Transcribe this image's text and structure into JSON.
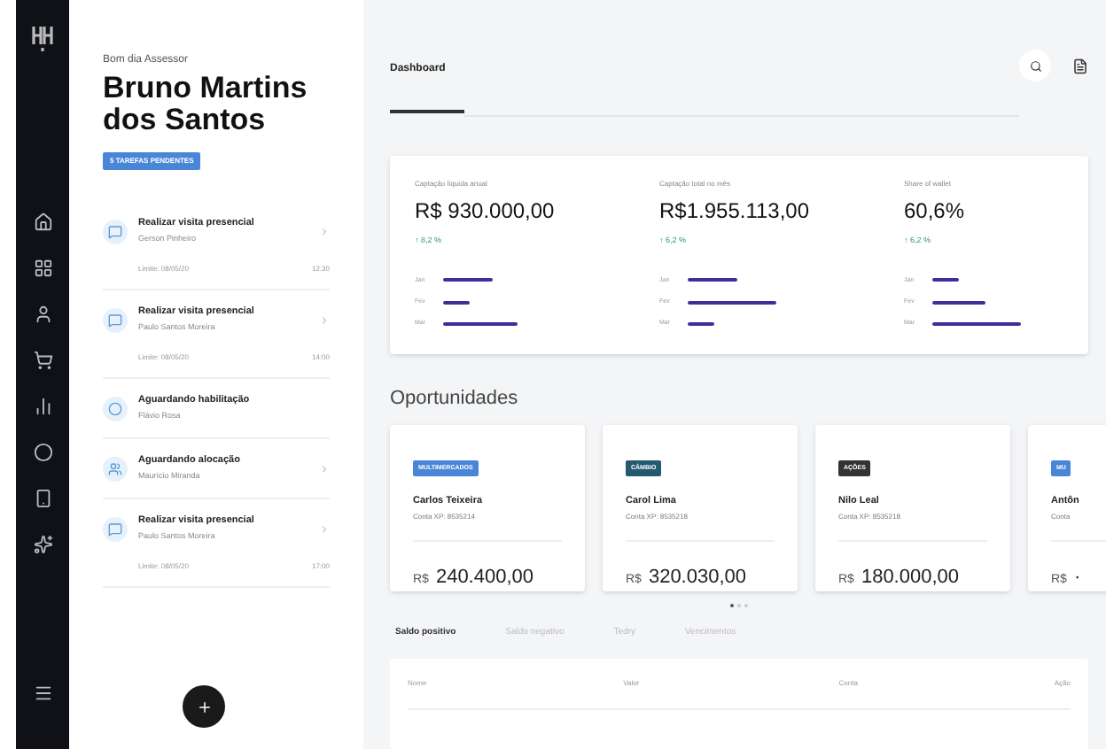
{
  "profile": {
    "greeting": "Bom dia Assessor",
    "name": "Bruno Martins dos Santos",
    "badge": "5 TAREFAS PENDENTES"
  },
  "tasks": [
    {
      "kind": "visit",
      "title": "Realizar visita presencial",
      "client": "Gerson Pinheiro",
      "deadline": "Limite: 08/05/20",
      "time": "12:30"
    },
    {
      "kind": "visit",
      "title": "Realizar visita presencial",
      "client": "Paulo Santos Moreira",
      "deadline": "Limite: 08/05/20",
      "time": "14:00"
    },
    {
      "kind": "waiting",
      "title": "Aguardando habilitação",
      "client": "Flávio Rosa"
    },
    {
      "kind": "allocation",
      "title": "Aguardando alocação",
      "client": "Maurício Miranda"
    },
    {
      "kind": "visit",
      "title": "Realizar visita presencial",
      "client": "Paulo Santos Moreira",
      "deadline": "Limite: 08/05/20",
      "time": "17:00"
    }
  ],
  "header": {
    "tabs": [
      {
        "label": "Dashboard",
        "selected": true
      }
    ]
  },
  "kpis": [
    {
      "label": "Captação líquida anual",
      "value": "R$ 930.000,00",
      "change": "↑ 8,2 %",
      "bars": [
        {
          "label": "Jan"
        },
        {
          "label": "Fev"
        },
        {
          "label": "Mar"
        }
      ]
    },
    {
      "label": "Captação total no mês",
      "value": "R$1.955.113,00",
      "change": "↑ 6,2 %",
      "bars": [
        {
          "label": "Jan"
        },
        {
          "label": "Fev"
        },
        {
          "label": "Mar"
        }
      ]
    },
    {
      "label": "Share of wallet",
      "value": "60,6%",
      "change": "↑ 6,2 %",
      "bars": [
        {
          "label": "Jan"
        },
        {
          "label": "Fev"
        },
        {
          "label": "Mar"
        }
      ]
    }
  ],
  "opportunities": {
    "title": "Oportunidades",
    "cards": [
      {
        "tag": "MULTIMERCADOS",
        "color": "#4a86d8",
        "name": "Carlos Teixeira",
        "account": "Conta XP: 8535214",
        "amount_prefix": "R$",
        "amount": "240.400,00"
      },
      {
        "tag": "CÂMBIO",
        "color": "#235a70",
        "name": "Carol Lima",
        "account": "Conta XP: 8535218",
        "amount_prefix": "R$",
        "amount": "320.030,00"
      },
      {
        "tag": "AÇÕES",
        "color": "#333333",
        "name": "Nilo Leal",
        "account": "Conta XP: 8535218",
        "amount_prefix": "R$",
        "amount": "180.000,00"
      },
      {
        "tag": "MU",
        "color": "#4a86d8",
        "name": "Antôn",
        "account": "Conta",
        "amount_prefix": "R$",
        "amount": "·"
      }
    ],
    "pages": [
      {
        "selected": true
      },
      {
        "selected": false
      },
      {
        "selected": false
      }
    ]
  },
  "balance_tabs": [
    {
      "label": "Saldo positivo",
      "selected": true
    },
    {
      "label": "Saldo negativo",
      "selected": false
    },
    {
      "label": "Tedry",
      "selected": false
    },
    {
      "label": "Vencimentos",
      "selected": false
    }
  ],
  "table": {
    "columns": [
      "Nome",
      "Valor",
      "Conta",
      "Ação"
    ]
  }
}
